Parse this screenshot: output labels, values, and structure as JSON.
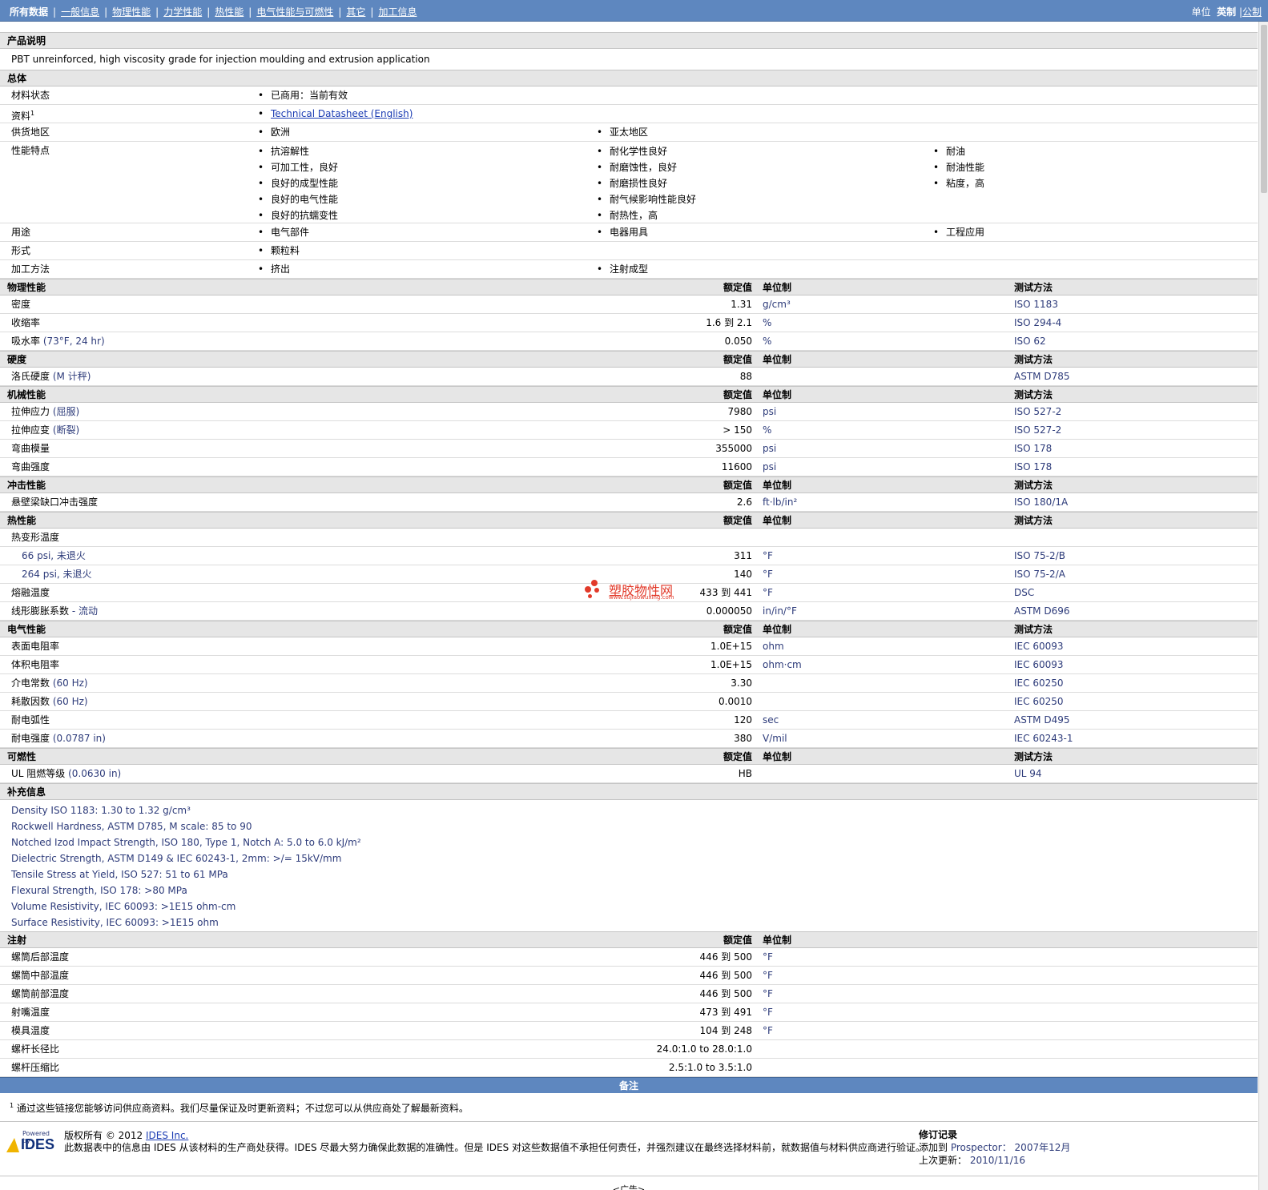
{
  "nav": {
    "tabs": [
      "所有数据",
      "一般信息",
      "物理性能",
      "力学性能",
      "热性能",
      "电气性能与可燃性",
      "其它",
      "加工信息"
    ],
    "units_label": "单位",
    "unit_en": "英制",
    "unit_metric": "公制"
  },
  "sections": {
    "desc": "产品说明",
    "general": "总体",
    "physical": "物理性能",
    "hardness": "硬度",
    "mechanical": "机械性能",
    "impact": "冲击性能",
    "thermal": "热性能",
    "electrical": "电气性能",
    "flammability": "可燃性",
    "supplemental": "补充信息",
    "injection": "注射"
  },
  "col": {
    "nominal": "额定值",
    "unit": "单位制",
    "method": "测试方法"
  },
  "description": "PBT unreinforced, high viscosity grade for injection moulding and extrusion application",
  "general": {
    "status_label": "材料状态",
    "status": "已商用：当前有效",
    "doc_label": "资料",
    "doc_sup": "1",
    "doc_link": "Technical Datasheet (English)",
    "region_label": "供货地区",
    "regions": [
      "欧洲",
      "亚太地区"
    ],
    "features_label": "性能特点",
    "features_c1": [
      "抗溶解性",
      "可加工性，良好",
      "良好的成型性能",
      "良好的电气性能",
      "良好的抗蠕变性"
    ],
    "features_c2": [
      "耐化学性良好",
      "耐磨蚀性，良好",
      "耐磨损性良好",
      "耐气候影响性能良好",
      "耐热性，高"
    ],
    "features_c3": [
      "耐油",
      "耐油性能",
      "粘度，高"
    ],
    "use_label": "用途",
    "uses": [
      "电气部件",
      "电器用具",
      "工程应用"
    ],
    "form_label": "形式",
    "form": "颗粒料",
    "proc_label": "加工方法",
    "procs": [
      "挤出",
      "注射成型"
    ]
  },
  "physical": [
    {
      "label": "密度",
      "cond": "",
      "value": "1.31",
      "unit": "g/cm³",
      "method": "ISO 1183"
    },
    {
      "label": "收缩率",
      "cond": "",
      "value": "1.6 到  2.1",
      "unit": "%",
      "method": "ISO 294-4"
    },
    {
      "label": "吸水率",
      "cond": "(73°F, 24 hr)",
      "value": "0.050",
      "unit": "%",
      "method": "ISO 62"
    }
  ],
  "hardness": [
    {
      "label": "洛氏硬度",
      "cond": "(M 计秤)",
      "value": "88",
      "unit": "",
      "method": "ASTM D785"
    }
  ],
  "mechanical": [
    {
      "label": "拉伸应力",
      "cond": "(屈服)",
      "value": "7980",
      "unit": "psi",
      "method": "ISO 527-2"
    },
    {
      "label": "拉伸应变",
      "cond": "(断裂)",
      "value": "> 150",
      "unit": "%",
      "method": "ISO 527-2"
    },
    {
      "label": "弯曲模量",
      "cond": "",
      "value": "355000",
      "unit": "psi",
      "method": "ISO 178"
    },
    {
      "label": "弯曲强度",
      "cond": "",
      "value": "11600",
      "unit": "psi",
      "method": "ISO 178"
    }
  ],
  "impact": [
    {
      "label": "悬壁梁缺口冲击强度",
      "cond": "",
      "value": "2.6",
      "unit": "ft·lb/in²",
      "method": "ISO 180/1A"
    }
  ],
  "thermal": {
    "hdt_label": "热变形温度",
    "hdt": [
      {
        "label": "66 psi, 未退火",
        "value": "311",
        "unit": "°F",
        "method": "ISO 75-2/B"
      },
      {
        "label": "264 psi, 未退火",
        "value": "140",
        "unit": "°F",
        "method": "ISO 75-2/A"
      }
    ],
    "rows": [
      {
        "label": "熔融温度",
        "cond": "",
        "value": "433 到  441",
        "unit": "°F",
        "method": "DSC"
      },
      {
        "label": "线形膨胀系数",
        "cond": "- 流动",
        "value": "0.000050",
        "unit": "in/in/°F",
        "method": "ASTM D696"
      }
    ]
  },
  "electrical": [
    {
      "label": "表面电阻率",
      "cond": "",
      "value": "1.0E+15",
      "unit": "ohm",
      "method": "IEC 60093"
    },
    {
      "label": "体积电阻率",
      "cond": "",
      "value": "1.0E+15",
      "unit": "ohm·cm",
      "method": "IEC 60093"
    },
    {
      "label": "介电常数",
      "cond": "(60 Hz)",
      "value": "3.30",
      "unit": "",
      "method": "IEC 60250"
    },
    {
      "label": "耗散因数",
      "cond": "(60 Hz)",
      "value": "0.0010",
      "unit": "",
      "method": "IEC 60250"
    },
    {
      "label": "耐电弧性",
      "cond": "",
      "value": "120",
      "unit": "sec",
      "method": "ASTM D495"
    },
    {
      "label": "耐电强度",
      "cond": "(0.0787 in)",
      "value": "380",
      "unit": "V/mil",
      "method": "IEC 60243-1"
    }
  ],
  "flammability": [
    {
      "label": "UL 阻燃等级",
      "cond": "(0.0630 in)",
      "value": "HB",
      "unit": "",
      "method": "UL 94"
    }
  ],
  "supplemental": [
    "Density ISO 1183: 1.30 to 1.32 g/cm³",
    "Rockwell Hardness, ASTM D785, M scale: 85 to 90",
    "Notched Izod Impact Strength, ISO 180, Type 1, Notch A: 5.0 to 6.0 kJ/m²",
    "Dielectric Strength, ASTM D149 & IEC 60243-1, 2mm: >/= 15kV/mm",
    "Tensile Stress at Yield, ISO 527: 51 to 61 MPa",
    "Flexural Strength, ISO 178: >80 MPa",
    "Volume Resistivity, IEC 60093: >1E15 ohm-cm",
    "Surface Resistivity, IEC 60093: >1E15 ohm"
  ],
  "injection": [
    {
      "label": "螺筒后部温度",
      "value": "446 到  500",
      "unit": "°F"
    },
    {
      "label": "螺筒中部温度",
      "value": "446 到  500",
      "unit": "°F"
    },
    {
      "label": "螺筒前部温度",
      "value": "446 到  500",
      "unit": "°F"
    },
    {
      "label": "射嘴温度",
      "value": "473 到  491",
      "unit": "°F"
    },
    {
      "label": "模具温度",
      "value": "104 到  248",
      "unit": "°F"
    },
    {
      "label": "螺杆长径比",
      "value": "24.0:1.0 to 28.0:1.0",
      "unit": ""
    },
    {
      "label": "螺杆压缩比",
      "value": "2.5:1.0 to 3.5:1.0",
      "unit": ""
    }
  ],
  "notes": {
    "title": "备注",
    "sup": "1",
    "text": "通过这些链接您能够访问供应商资料。我们尽量保证及时更新资料；不过您可以从供应商处了解最新资料。"
  },
  "footer": {
    "powered": "Powered by",
    "logo": "IDES",
    "copy": "版权所有 © 2012",
    "ides_link": "IDES Inc.",
    "disclaimer": "此数据表中的信息由 IDES 从该材料的生产商处获得。IDES 尽最大努力确保此数据的准确性。但是 IDES 对这些数据值不承担任何责任，并强烈建议在最终选择材料前，就数据值与材料供应商进行验证。",
    "rev_title": "修订记录",
    "added_label": "添加到",
    "prospector": "Prospector：",
    "added_date": "2007年12月",
    "updated_label": "上次更新：",
    "updated_date": "2010/11/16"
  },
  "ad": "<广告>",
  "watermark": {
    "name": "塑胶物性网",
    "url": "www.sujiaowuxing.com"
  }
}
